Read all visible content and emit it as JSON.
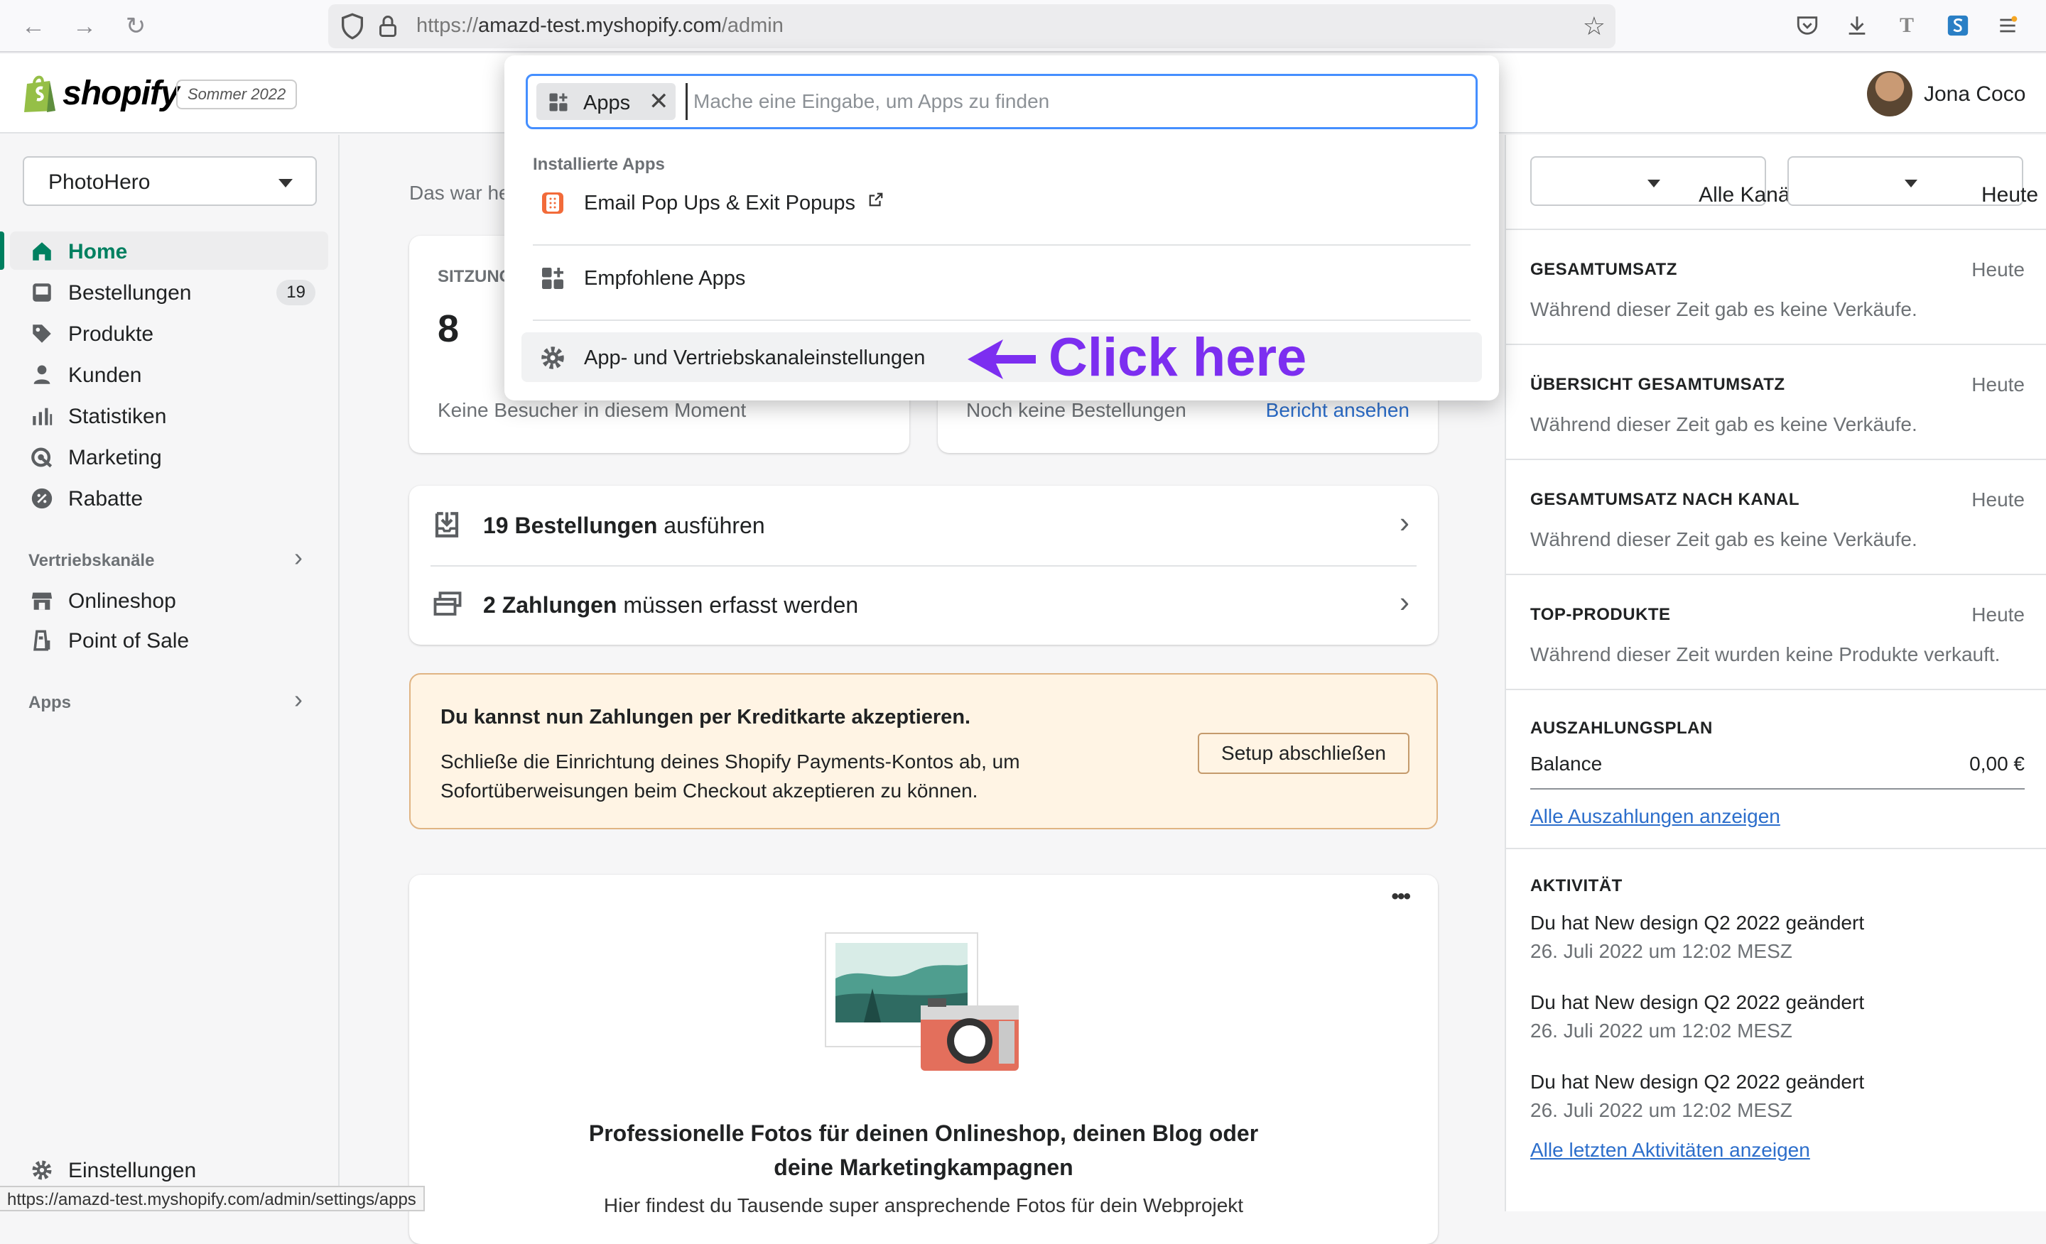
{
  "browser": {
    "url_prefix": "https://",
    "url_host": "amazd-test.myshopify.com",
    "url_path": "/admin",
    "status_url": "https://amazd-test.myshopify.com/admin/settings/apps"
  },
  "topbar": {
    "logo_text": "shopify",
    "season_badge": "Sommer 2022",
    "user_name": "Jona Coco"
  },
  "sidebar": {
    "store_name": "PhotoHero",
    "items": [
      {
        "label": "Home",
        "icon": "home-icon",
        "active": true
      },
      {
        "label": "Bestellungen",
        "icon": "orders-icon",
        "badge": "19"
      },
      {
        "label": "Produkte",
        "icon": "tag-icon"
      },
      {
        "label": "Kunden",
        "icon": "person-icon"
      },
      {
        "label": "Statistiken",
        "icon": "bar-chart-icon"
      },
      {
        "label": "Marketing",
        "icon": "target-icon"
      },
      {
        "label": "Rabatte",
        "icon": "discount-icon"
      }
    ],
    "sales_channels_heading": "Vertriebskanäle",
    "channels": [
      {
        "label": "Onlineshop",
        "icon": "store-icon"
      },
      {
        "label": "Point of Sale",
        "icon": "pos-icon"
      }
    ],
    "apps_heading": "Apps",
    "settings_label": "Einstellungen"
  },
  "main": {
    "greeting": "Das war heute",
    "sessions_label": "SITZUNGEN",
    "sessions_value": "8",
    "no_visitors": "Keine Besucher in diesem Moment",
    "no_orders": "Noch keine Bestellungen",
    "view_report": "Bericht ansehen",
    "tasks": [
      {
        "bold": "19 Bestellungen",
        "rest": " ausführen",
        "icon": "inbox-download-icon"
      },
      {
        "bold": "2 Zahlungen",
        "rest": " müssen erfasst werden",
        "icon": "payment-capture-icon"
      }
    ],
    "banner": {
      "title": "Du kannst nun Zahlungen per Kreditkarte akzeptieren.",
      "body_line1": "Schließe die Einrichtung deines Shopify Payments-Kontos ab, um",
      "body_line2": "Sofortüberweisungen beim Checkout akzeptieren zu können.",
      "button": "Setup abschließen"
    },
    "photo_card": {
      "title_line1": "Professionelle Fotos für deinen Onlineshop, deinen Blog oder",
      "title_line2": "deine Marketingkampagnen",
      "body": "Hier findest du Tausende super ansprechende Fotos für dein Webprojekt",
      "more": "•••"
    }
  },
  "right": {
    "channel_select": "Alle Kanäle",
    "date_select": "Heute",
    "sections": [
      {
        "heading": "GESAMTUMSATZ",
        "period": "Heute",
        "text": "Während dieser Zeit gab es keine Verkäufe."
      },
      {
        "heading": "ÜBERSICHT GESAMTUMSATZ",
        "period": "Heute",
        "text": "Während dieser Zeit gab es keine Verkäufe."
      },
      {
        "heading": "GESAMTUMSATZ NACH KANAL",
        "period": "Heute",
        "text": "Während dieser Zeit gab es keine Verkäufe."
      },
      {
        "heading": "TOP-PRODUKTE",
        "period": "Heute",
        "text": "Während dieser Zeit wurden keine Produkte verkauft."
      }
    ],
    "payout": {
      "heading": "AUSZAHLUNGSPLAN",
      "balance_label": "Balance",
      "balance_value": "0,00 €",
      "link": "Alle Auszahlungen anzeigen"
    },
    "activity": {
      "heading": "AKTIVITÄT",
      "items": [
        {
          "text": "Du hat New design Q2 2022 geändert",
          "time": "26. Juli 2022 um 12:02 MESZ"
        },
        {
          "text": "Du hat New design Q2 2022 geändert",
          "time": "26. Juli 2022 um 12:02 MESZ"
        },
        {
          "text": "Du hat New design Q2 2022 geändert",
          "time": "26. Juli 2022 um 12:02 MESZ"
        }
      ],
      "link": "Alle letzten Aktivitäten anzeigen"
    }
  },
  "dropdown": {
    "chip_label": "Apps",
    "search_placeholder": "Mache eine Eingabe, um Apps zu finden",
    "installed_heading": "Installierte Apps",
    "items": [
      {
        "label": "Email Pop Ups & Exit Popups",
        "icon": "popup-app-icon"
      },
      {
        "label": "Empfohlene Apps",
        "icon": "apps-grid-icon"
      },
      {
        "label": "App- und Vertriebskanaleinstellungen",
        "icon": "gear-icon"
      }
    ]
  },
  "annotation": {
    "text": "Click here",
    "color": "#7c2ef0"
  }
}
